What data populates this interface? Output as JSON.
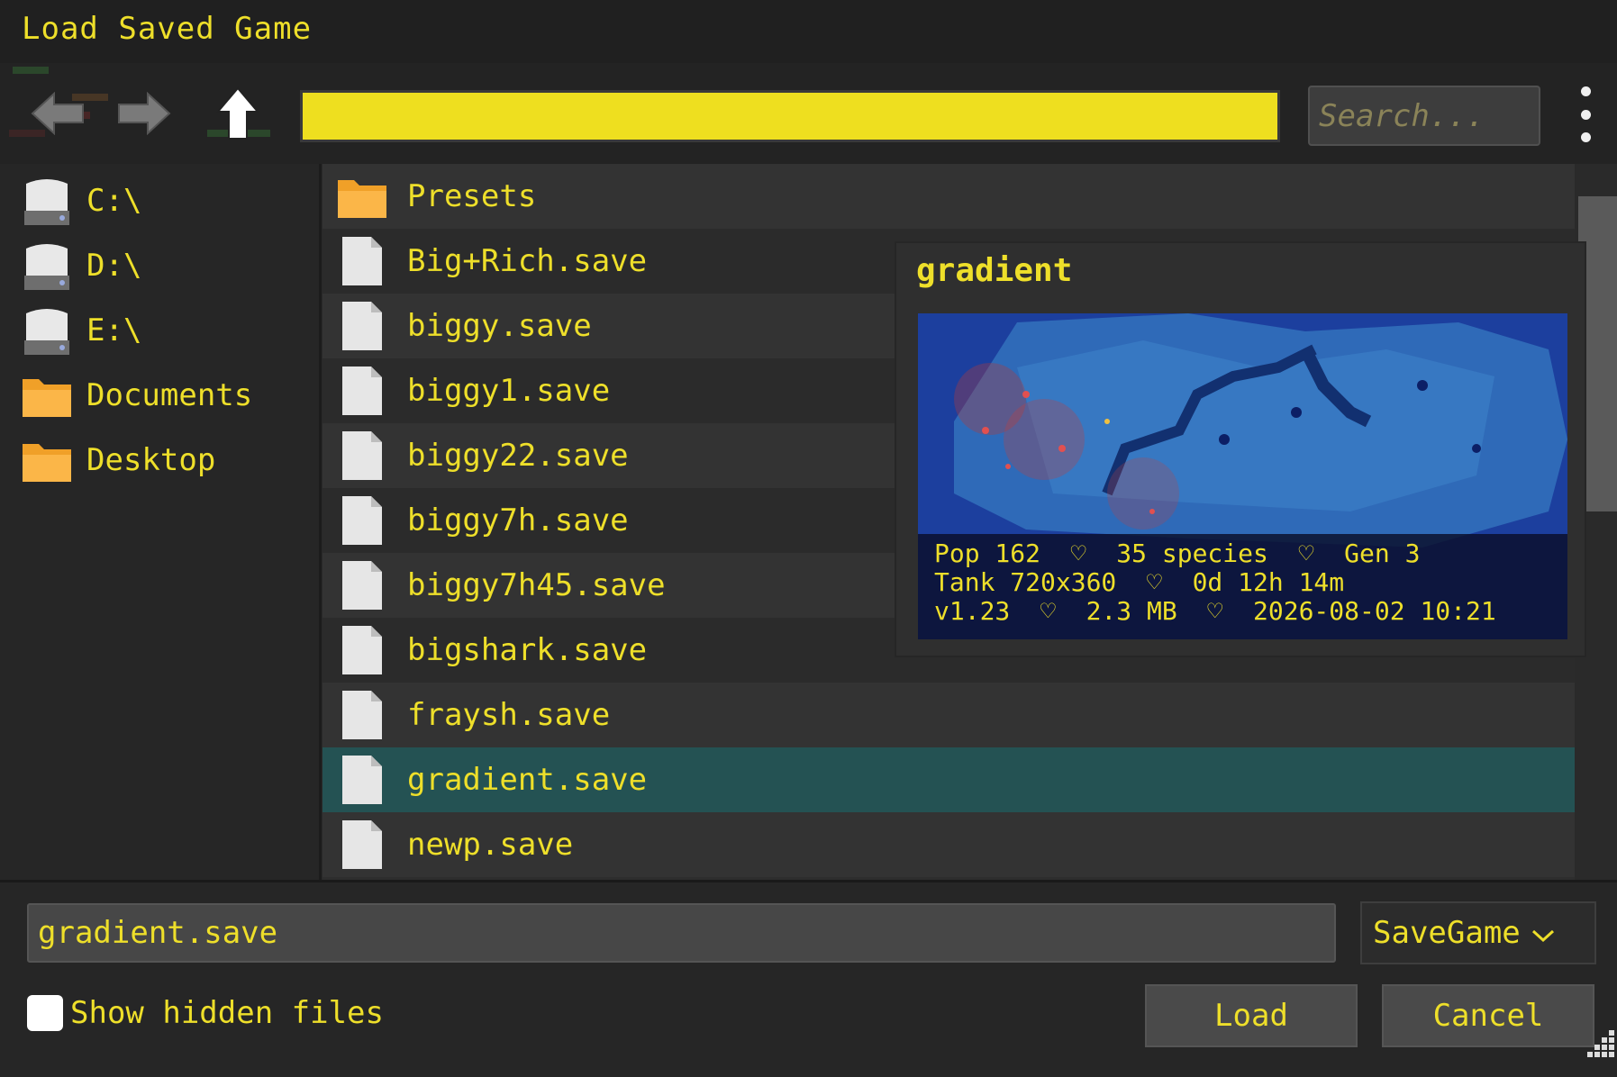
{
  "window": {
    "title": "Load Saved Game"
  },
  "toolbar": {
    "back_icon": "arrow-left-icon",
    "forward_icon": "arrow-right-icon",
    "up_icon": "arrow-up-icon",
    "path": "",
    "search_placeholder": "Search...",
    "menu_icon": "kebab-menu-icon",
    "path_color": "#eedf1f"
  },
  "sidebar": {
    "items": [
      {
        "label": "C:\\",
        "icon": "drive-icon"
      },
      {
        "label": "D:\\",
        "icon": "drive-icon"
      },
      {
        "label": "E:\\",
        "icon": "drive-icon"
      },
      {
        "label": "Documents",
        "icon": "folder-icon"
      },
      {
        "label": "Desktop",
        "icon": "folder-icon"
      }
    ]
  },
  "files": [
    {
      "name": "Presets",
      "icon": "folder-icon"
    },
    {
      "name": "Big+Rich.save",
      "icon": "file-icon"
    },
    {
      "name": "biggy.save",
      "icon": "file-icon"
    },
    {
      "name": "biggy1.save",
      "icon": "file-icon"
    },
    {
      "name": "biggy22.save",
      "icon": "file-icon"
    },
    {
      "name": "biggy7h.save",
      "icon": "file-icon"
    },
    {
      "name": "biggy7h45.save",
      "icon": "file-icon"
    },
    {
      "name": "bigshark.save",
      "icon": "file-icon"
    },
    {
      "name": "fraysh.save",
      "icon": "file-icon"
    },
    {
      "name": "gradient.save",
      "icon": "file-icon",
      "selected": true
    },
    {
      "name": "newp.save",
      "icon": "file-icon"
    }
  ],
  "preview": {
    "title": "gradient",
    "line1": "Pop 162  ♡  35 species  ♡  Gen 3",
    "line2": "Tank 720x360  ♡  0d 12h 14m",
    "line3": "v1.23  ♡  2.3 MB  ♡  2026-08-02 10:21"
  },
  "footer": {
    "filename": "gradient.save",
    "filetype": "SaveGame",
    "show_hidden_label": "Show hidden files",
    "show_hidden_checked": false,
    "load_label": "Load",
    "cancel_label": "Cancel"
  },
  "colors": {
    "accent_text": "#eedf2a",
    "selected_row": "#245253",
    "background": "#2a2a2a"
  }
}
